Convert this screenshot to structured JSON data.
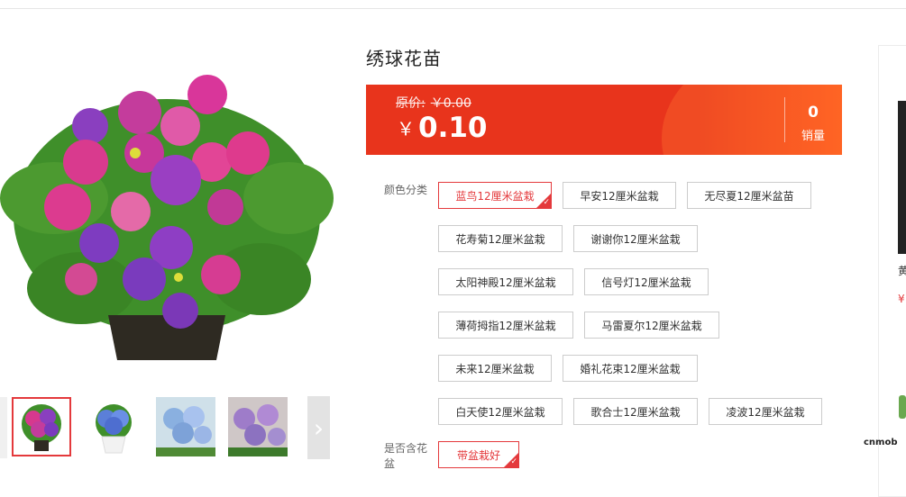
{
  "product": {
    "title": "绣球花苗"
  },
  "price": {
    "original_label": "原价:",
    "original_value": "￥0.00",
    "currency": "￥",
    "current": "0.10",
    "sales_count": "0",
    "sales_label": "销量"
  },
  "options": {
    "color_label": "颜色分类",
    "colors": [
      "蓝鸟12厘米盆栽",
      "早安12厘米盆栽",
      "无尽夏12厘米盆苗",
      "花寿菊12厘米盆栽",
      "谢谢你12厘米盆栽",
      "太阳神殿12厘米盆栽",
      "信号灯12厘米盆栽",
      "薄荷拇指12厘米盆栽",
      "马雷夏尔12厘米盆栽",
      "未来12厘米盆栽",
      "婚礼花束12厘米盆栽",
      "白天使12厘米盆栽",
      "歌合士12厘米盆栽",
      "凌波12厘米盆栽"
    ],
    "selected_color": "蓝鸟12厘米盆栽",
    "pot_label": "是否含花盆",
    "pot_options": [
      "带盆栽好"
    ],
    "selected_pot": "带盆栽好",
    "check_glyph": "✓"
  },
  "gallery": {
    "next_glyph": "›"
  },
  "recommendation": {
    "name_fragment": "黄",
    "price_fragment": "¥"
  },
  "watermark": "cnmob",
  "colors": {
    "accent": "#e4393c",
    "price_bar": "#e8341c"
  }
}
